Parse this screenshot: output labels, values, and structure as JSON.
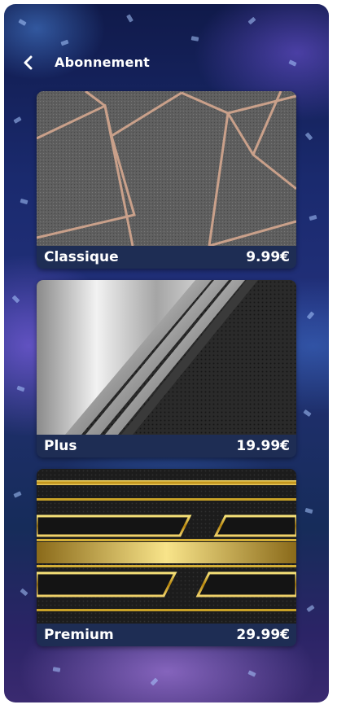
{
  "header": {
    "back_icon": "chevron-left-icon",
    "title": "Abonnement"
  },
  "plans": [
    {
      "name": "Classique",
      "price": "9.99€",
      "image": "grey-marble-rose-gold-lines-texture"
    },
    {
      "name": "Plus",
      "price": "19.99€",
      "image": "silver-metal-stripes-texture"
    },
    {
      "name": "Premium",
      "price": "29.99€",
      "image": "black-gold-bars-texture"
    }
  ],
  "colors": {
    "label_bar": "#1e2d54",
    "text": "#ffffff"
  }
}
